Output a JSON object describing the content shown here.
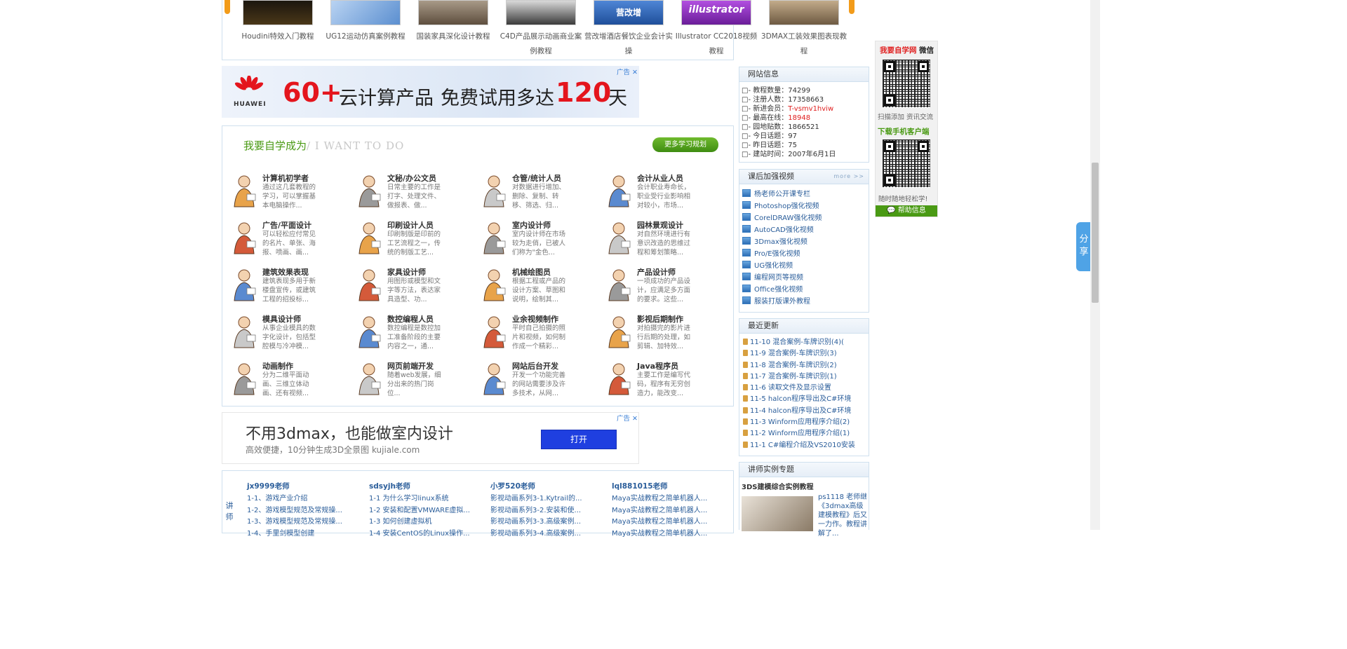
{
  "carousel": {
    "items": [
      {
        "caption": "Houdini特效入门教程",
        "color": "#2a2418"
      },
      {
        "caption": "UG12运动仿真案例教程",
        "color": "#6f9ed9"
      },
      {
        "caption": "国装家具深化设计教程",
        "color": "#8c7a66"
      },
      {
        "caption": "C4D产品展示动画商业案例教程",
        "color": "#3b3b3b"
      },
      {
        "caption": "营改增酒店餐饮企业会计实操",
        "color": "#2d5fa8",
        "thumb_text": "营改增"
      },
      {
        "caption": "Illustrator CC2018视频教程",
        "color": "#8a2fb8",
        "thumb_text": "illustrator"
      },
      {
        "caption": "3DMAX工装效果图表现教程",
        "color": "#a0896e"
      }
    ]
  },
  "ad1": {
    "tag": "广告",
    "brand": "HUAWEI",
    "big": "60+",
    "text1": "云计算产品",
    "text2": "免费试用多达",
    "num": "120",
    "unit": "天"
  },
  "want": {
    "title": "我要自学成为",
    "title_en": "/ I WANT TO DO",
    "more_label": "更多学习规划",
    "careers": [
      {
        "name": "计算机初学者",
        "desc": "通过这几套教程的学习，可以掌握基本电脑操作..."
      },
      {
        "name": "文秘/办公文员",
        "desc": "日常主要的工作是打字、处理文件、做报表、做..."
      },
      {
        "name": "仓管/统计人员",
        "desc": "对数据进行增加、删除、复制、转移、筛选、归..."
      },
      {
        "name": "会计从业人员",
        "desc": "会计职业寿命长，职业受行业影响相对较小，市场..."
      },
      {
        "name": "广告/平面设计",
        "desc": "可以轻松应付常见的名片、单张、海报、喷画、画..."
      },
      {
        "name": "印刷设计人员",
        "desc": "印刷制版是印前的工艺流程之一，传统的制版工艺..."
      },
      {
        "name": "室内设计师",
        "desc": "室内设计师在市场较为走俏，已被人们称为\"金色..."
      },
      {
        "name": "园林景观设计",
        "desc": "对自然环境进行有意识改造的思维过程和筹划策略..."
      },
      {
        "name": "建筑效果表现",
        "desc": "建筑表现多用于新楼盘宣传，或建筑工程的招投标..."
      },
      {
        "name": "家具设计师",
        "desc": "用图形或模型和文字等方法，表达家具造型、功..."
      },
      {
        "name": "机械绘图员",
        "desc": "根据工程或产品的设计方案、草图和说明，绘制其..."
      },
      {
        "name": "产品设计师",
        "desc": "一项成功的产品设计，应满足多方面的要求。这些..."
      },
      {
        "name": "模具设计师",
        "desc": "从事企业模具的数字化设计，包括型腔模与冷冲模..."
      },
      {
        "name": "数控编程人员",
        "desc": "数控编程是数控加工准备阶段的主要内容之一，通..."
      },
      {
        "name": "业余视频制作",
        "desc": "平时自己拍摄的照片和视频，如何制作成一个精彩..."
      },
      {
        "name": "影视后期制作",
        "desc": "对拍摄完的影片进行后期的处理，如剪辑、加特效..."
      },
      {
        "name": "动画制作",
        "desc": "分为二维平面动画、三维立体动画、还有视频..."
      },
      {
        "name": "网页前端开发",
        "desc": "随着web发展，细分出来的热门岗位..."
      },
      {
        "name": "网站后台开发",
        "desc": "开发一个功能完善的网站需要涉及许多技术，从网..."
      },
      {
        "name": "Java程序员",
        "desc": "主要工作是编写代码，程序有无穷创造力，能改变..."
      }
    ]
  },
  "ad2": {
    "tag": "广告",
    "headline": "不用3dmax，也能做室内设计",
    "sub": "高效便捷，10分钟生成3D全景图 kujiale.com",
    "button": "打开"
  },
  "teachers": {
    "side_label": "讲师",
    "columns": [
      {
        "name": "jx9999老师",
        "items": [
          "1-1、游戏产业介绍",
          "1-2、游戏模型规范及常规操...",
          "1-3、游戏模型规范及常规操...",
          "1-4、手里剑模型创建"
        ]
      },
      {
        "name": "sdsyjh老师",
        "items": [
          "1-1 为什么学习linux系统",
          "1-2 安装和配置VMWARE虚拟...",
          "1-3 如何创建虚拟机",
          "1-4 安装CentOS的Linux操作..."
        ]
      },
      {
        "name": "小罗520老师",
        "items": [
          "影视动画系列3-1.Kytrail的...",
          "影视动画系列3-2.安装和使...",
          "影视动画系列3-3.高级案例...",
          "影视动画系列3-4.高级案例..."
        ]
      },
      {
        "name": "lql881015老师",
        "items": [
          "Maya实战教程之简单机器人...",
          "Maya实战教程之简单机器人...",
          "Maya实战教程之简单机器人...",
          "Maya实战教程之简单机器人..."
        ]
      }
    ]
  },
  "site_info": {
    "title": "网站信息",
    "rows": [
      {
        "label": "□- 教程数量：",
        "value": "74299",
        "red": false
      },
      {
        "label": "□- 注册人数：",
        "value": "17358663",
        "red": false
      },
      {
        "label": "□- 新进会员：",
        "value": "T-vsmv1hviw",
        "red": true
      },
      {
        "label": "□- 最高在线：",
        "value": "18948",
        "red": true
      },
      {
        "label": "□- 园地贴数：",
        "value": "1866521",
        "red": false
      },
      {
        "label": "□- 今日话题：",
        "value": "97",
        "red": false
      },
      {
        "label": "□- 昨日话题：",
        "value": "75",
        "red": false
      },
      {
        "label": "□- 建站时间：",
        "value": "2007年6月1日",
        "red": false
      }
    ]
  },
  "videos": {
    "title": "课后加强视频",
    "more": "more >>",
    "items": [
      "杨老师公开课专栏",
      "Photoshop强化视频",
      "CorelDRAW强化视频",
      "AutoCAD强化视频",
      "3Dmax强化视频",
      "Pro/E强化视频",
      "UG强化视频",
      "编程网页等视频",
      "Office强化视频",
      "服装打版课外教程"
    ]
  },
  "updates": {
    "title": "最近更新",
    "items": [
      "11-10 混合案例-车牌识别(4)(",
      "11-9 混合案例-车牌识别(3)",
      "11-8 混合案例-车牌识别(2)",
      "11-7 混合案例-车牌识别(1)",
      "11-6 读取文件及显示设置",
      "11-5 halcon程序导出及C#环境",
      "11-4 halcon程序导出及C#环境",
      "11-3 Winform应用程序介绍(2)",
      "11-2 Winform应用程序介绍(1)",
      "11-1 C#编程介绍及VS2010安装"
    ]
  },
  "lecturer_topics": {
    "title": "讲师实例专题",
    "subtitle": "3DS建模综合实例教程",
    "text": "ps1118 老师继《3dmax高级建模教程》后又一力作。教程讲解了..."
  },
  "qr_float": {
    "brand": "我要自学网",
    "wechat": "微信",
    "scan_label": "扫描添加",
    "news_label": "资讯交流",
    "app_label": "下载手机客户端",
    "anytime": "随时随地轻松学!",
    "help": "帮助信息"
  },
  "share": {
    "label": "分享"
  }
}
